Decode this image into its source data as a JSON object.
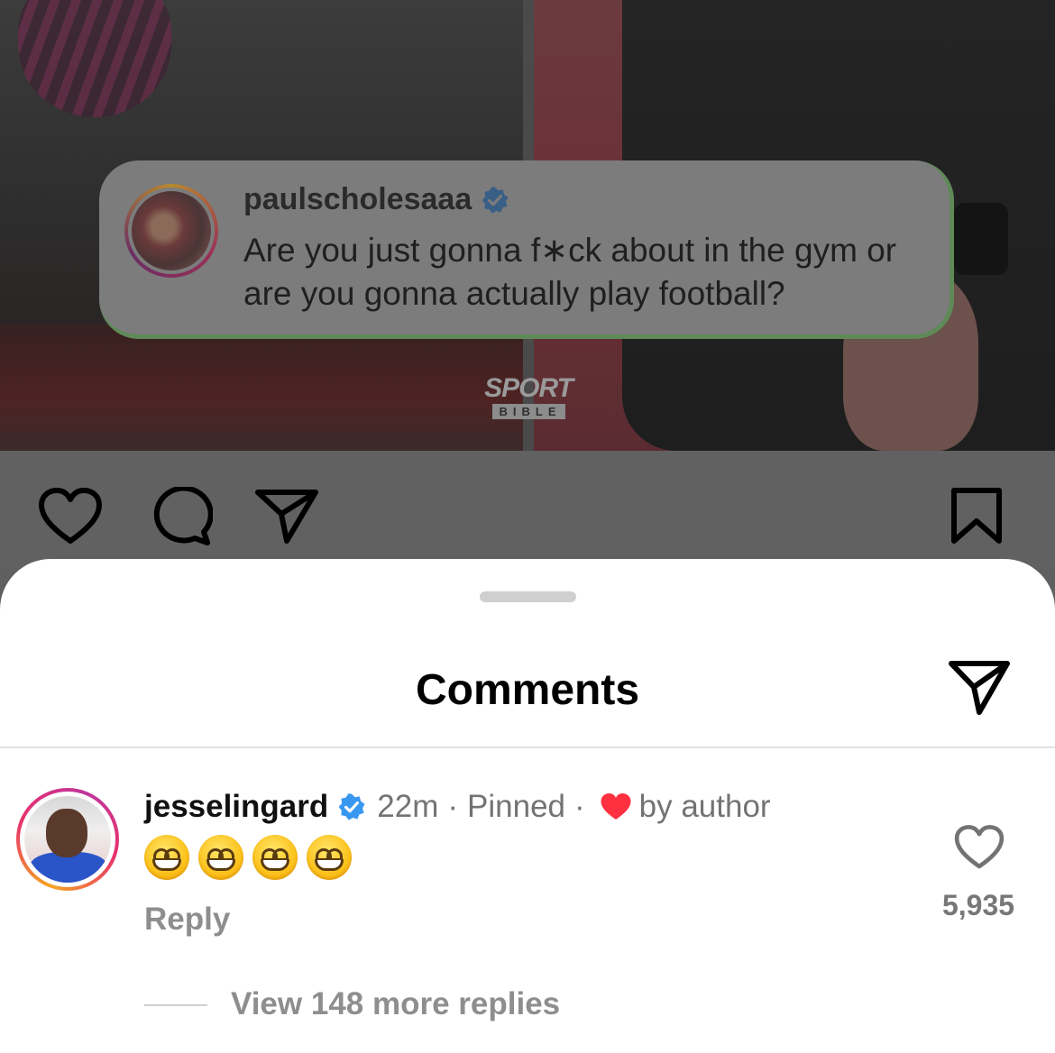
{
  "post": {
    "quote_username": "paulscholesaaa",
    "quote_text": "Are you just gonna f∗ck about in the gym or are you gonna actually play football?",
    "logo_top": "SPORT",
    "logo_bottom": "BIBLE"
  },
  "actions": {
    "icons": [
      "heart-icon",
      "comment-icon",
      "share-icon",
      "bookmark-icon"
    ]
  },
  "comments_sheet": {
    "title": "Comments",
    "share_icon": "share-icon",
    "comment": {
      "username": "jesselingard",
      "verified": true,
      "time": "22m",
      "separator": "·",
      "pinned": "Pinned",
      "liked_by_author": "by author",
      "emoji": [
        "😁",
        "😁",
        "😁",
        "😁"
      ],
      "reply_label": "Reply",
      "like_count": "5,935",
      "view_replies": "View 148 more replies"
    }
  },
  "colors": {
    "verified": "#3897f0",
    "author_heart": "#ff3040",
    "muted_text": "#737373"
  }
}
